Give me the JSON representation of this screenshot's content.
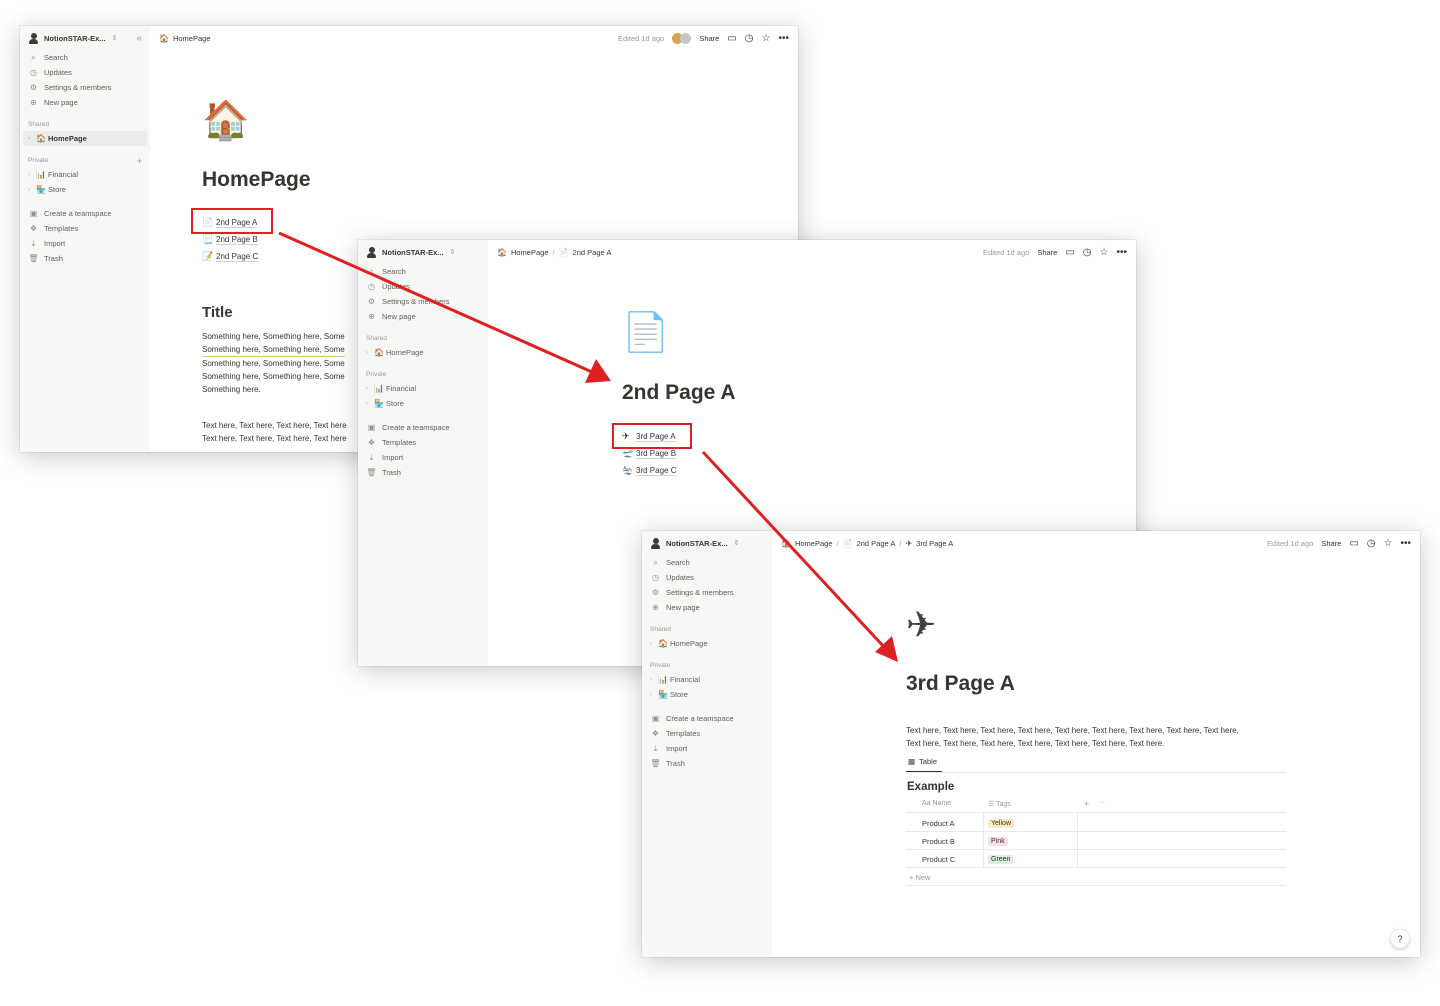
{
  "sidebar": {
    "workspace": "NotionSTAR-Ex...",
    "items": [
      {
        "label": "Search",
        "icon": "search-icon"
      },
      {
        "label": "Updates",
        "icon": "clock-icon"
      },
      {
        "label": "Settings & members",
        "icon": "gear-icon"
      },
      {
        "label": "New page",
        "icon": "plus-circle-icon"
      }
    ],
    "shared_label": "Shared",
    "shared_page": "HomePage",
    "private_label": "Private",
    "private_pages": [
      "Financial",
      "Store"
    ],
    "bottom_items": [
      {
        "label": "Create a teamspace",
        "icon": "teamspace-icon"
      },
      {
        "label": "Templates",
        "icon": "templates-icon"
      },
      {
        "label": "Import",
        "icon": "import-icon"
      },
      {
        "label": "Trash",
        "icon": "trash-icon"
      }
    ]
  },
  "topbar": {
    "edited": "Edited 1d ago",
    "share": "Share"
  },
  "win1": {
    "crumbs": [
      "HomePage"
    ],
    "title": "HomePage",
    "links": [
      "2nd Page A",
      "2nd Page B",
      "2nd Page C"
    ],
    "section_title": "Title",
    "para_lines": [
      "Something here, Something here, Some",
      "Something here, Something here, Some",
      "Something here, Something here, Some",
      "Something here, Something here, Some",
      "Something here."
    ],
    "text_lines": [
      "Text here, Text here, Text here, Text here",
      "Text here, Text here, Text here, Text here"
    ]
  },
  "win2": {
    "crumbs": [
      "HomePage",
      "2nd Page A"
    ],
    "title": "2nd Page A",
    "links": [
      "3rd Page A",
      "3rd Page B",
      "3rd Page C"
    ]
  },
  "win3": {
    "crumbs": [
      "HomePage",
      "2nd Page A",
      "3rd Page A"
    ],
    "title": "3rd Page A",
    "text_lines": [
      "Text here, Text here, Text here, Text here, Text here, Text here, Text here, Text here, Text here,",
      "Text here, Text here, Text here, Text here, Text here, Text here, Text here."
    ],
    "table_tab": "Table",
    "table_title": "Example",
    "col_name": "Name",
    "col_tags": "Tags",
    "rows": [
      {
        "name": "Product A",
        "tag": "Yellow"
      },
      {
        "name": "Product B",
        "tag": "Pink"
      },
      {
        "name": "Product C",
        "tag": "Green"
      }
    ],
    "new_row": "New",
    "help": "?"
  },
  "colors": {
    "annotation_red": "#e02020",
    "tag_yellow": "#fdecc8",
    "tag_pink": "#f5e0e9",
    "tag_green": "#dbeddb"
  }
}
